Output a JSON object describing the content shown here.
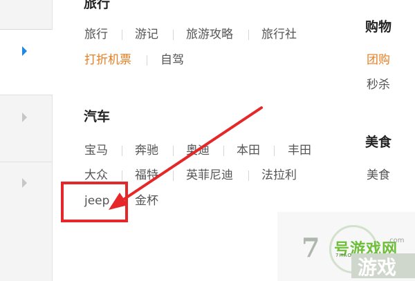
{
  "categories": [
    {
      "title": "旅行",
      "rows": [
        [
          "旅行",
          "游记",
          "旅游攻略",
          "旅行社"
        ],
        [
          "打折机票",
          "自驾"
        ]
      ],
      "highlighted": [
        "打折机票"
      ]
    },
    {
      "title": "汽车",
      "rows": [
        [
          "宝马",
          "奔驰",
          "奥迪",
          "本田",
          "丰田"
        ],
        [
          "大众",
          "福特",
          "英菲尼迪",
          "法拉利"
        ],
        [
          "jeep",
          "金杯"
        ]
      ],
      "highlighted": []
    }
  ],
  "right_column": [
    {
      "title": "购物",
      "items": [
        "团购",
        "秒杀"
      ],
      "highlighted": [
        "团购"
      ]
    },
    {
      "title": "美食",
      "items": [
        "美食"
      ]
    }
  ],
  "watermark": {
    "logo_number": "7",
    "brand": "号游戏网",
    "pinyin": "7HAOYOUXIWANG",
    "big_text": "游戏",
    "url": ".com"
  },
  "colors": {
    "highlight": "#e67e22",
    "annotation": "#e5272a",
    "active_arrow": "#1e88e5"
  }
}
